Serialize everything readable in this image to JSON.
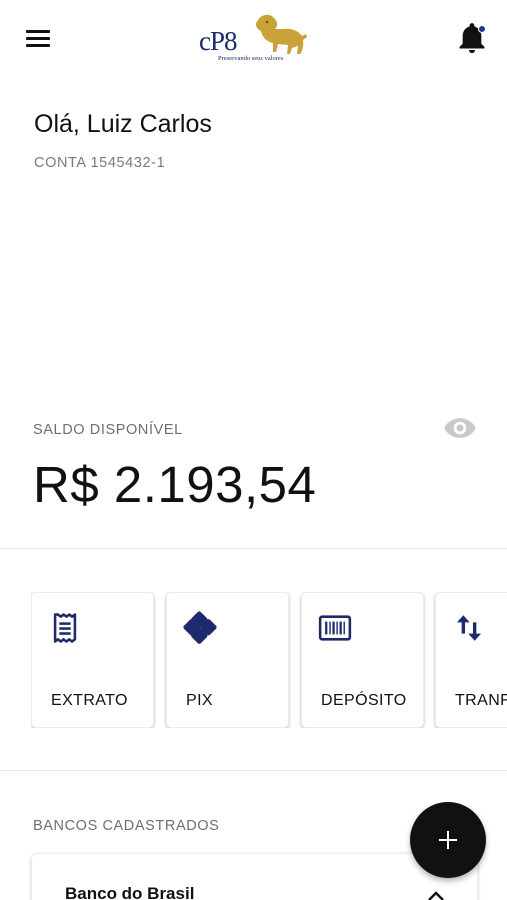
{
  "header": {
    "menu_icon": "hamburger-menu-icon",
    "logo_text": "cP8",
    "logo_tagline": "Preservando seus valores",
    "notification_icon": "bell-icon",
    "brand_navy": "#1d2b6c",
    "brand_gold": "#c9a23a"
  },
  "user": {
    "greeting": "Olá, Luiz Carlos",
    "account": "CONTA 1545432-1"
  },
  "balance": {
    "label": "SALDO DISPONÍVEL",
    "value": "R$ 2.193,54",
    "visibility_icon": "eye-icon"
  },
  "actions": [
    {
      "label": "EXTRATO",
      "icon": "receipt-icon"
    },
    {
      "label": "PIX",
      "icon": "pix-icon"
    },
    {
      "label": "DEPÓSITO",
      "icon": "barcode-icon"
    },
    {
      "label": "TRANF",
      "icon": "swap-vertical-icon"
    }
  ],
  "banks": {
    "label": "BANCOS CADASTRADOS",
    "items": [
      {
        "name": "Banco do Brasil",
        "icon": "chevron-up-icon"
      }
    ]
  },
  "fab": {
    "icon": "plus-icon"
  },
  "colors": {
    "icon_blue": "#1d2b6c",
    "text_muted": "#6f6f6f"
  }
}
